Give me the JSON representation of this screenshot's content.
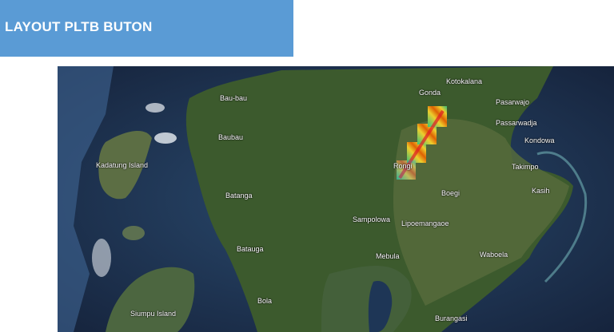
{
  "header": {
    "title": "LAYOUT PLTB BUTON"
  },
  "colors": {
    "title_bar": "#5a9bd5",
    "sea": "#1b2d4a",
    "land": "#3c5a2d"
  },
  "map": {
    "places": [
      {
        "id": "kotokalana",
        "label": "Kotokalana"
      },
      {
        "id": "gonda",
        "label": "Gonda"
      },
      {
        "id": "bau-bau-north",
        "label": "Bau-bau"
      },
      {
        "id": "pasarwajo",
        "label": "Pasarwajo"
      },
      {
        "id": "passarwadja",
        "label": "Passarwadja"
      },
      {
        "id": "kondowa",
        "label": "Kondowa"
      },
      {
        "id": "baubau",
        "label": "Baubau"
      },
      {
        "id": "kadatung-island",
        "label": "Kadatung Island"
      },
      {
        "id": "takimpo",
        "label": "Takimpo"
      },
      {
        "id": "rongi",
        "label": "Rongi"
      },
      {
        "id": "kasih",
        "label": "Kasih"
      },
      {
        "id": "batanga",
        "label": "Batanga"
      },
      {
        "id": "boegi",
        "label": "Boegi"
      },
      {
        "id": "sampolowa",
        "label": "Sampolowa"
      },
      {
        "id": "lipoemangaoe",
        "label": "Lipoemangaoe"
      },
      {
        "id": "batauga",
        "label": "Batauga"
      },
      {
        "id": "mebula",
        "label": "Mebula"
      },
      {
        "id": "waboela",
        "label": "Waboela"
      },
      {
        "id": "bola",
        "label": "Bola"
      },
      {
        "id": "siumpu-island",
        "label": "Siumpu Island"
      },
      {
        "id": "burangasi",
        "label": "Burangasi"
      }
    ]
  }
}
